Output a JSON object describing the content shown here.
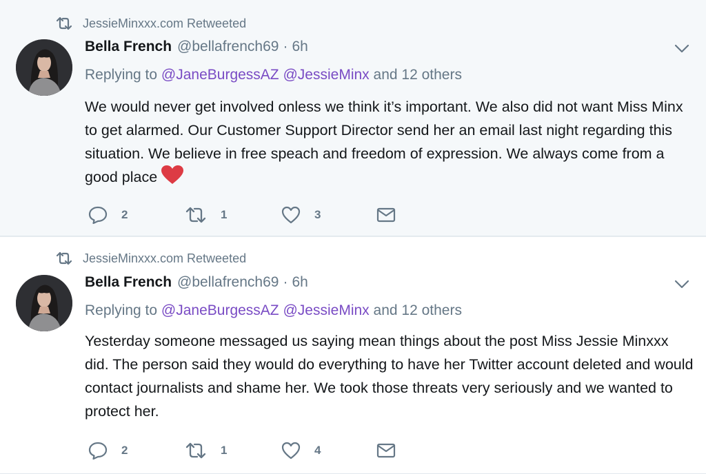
{
  "tweets": [
    {
      "retweeted_by": "JessieMinxxx.com Retweeted",
      "name": "Bella French",
      "handle": "@bellafrench69",
      "dot": "·",
      "time": "6h",
      "replying_prefix": "Replying to",
      "mention1": "@JaneBurgessAZ",
      "mention2": "@JessieMinx",
      "replying_suffix": "and 12 others",
      "text": "We would never get involved onless we think it’s important. We also did not want Miss Minx to get alarmed. Our Customer Support Director send her an email last night regarding this situation. We believe in free speach and freedom of expression. We always come from a good place",
      "emoji": "red-heart",
      "replies": "2",
      "retweets": "1",
      "likes": "3"
    },
    {
      "retweeted_by": "JessieMinxxx.com Retweeted",
      "name": "Bella French",
      "handle": "@bellafrench69",
      "dot": "·",
      "time": "6h",
      "replying_prefix": "Replying to",
      "mention1": "@JaneBurgessAZ",
      "mention2": "@JessieMinx",
      "replying_suffix": "and 12 others",
      "text": "Yesterday someone messaged us saying mean things about the post Miss Jessie Minxxx did. The person said they would do everything to have her Twitter account deleted and would contact journalists and shame her. We took those threats very seriously and we wanted to protect her.",
      "replies": "2",
      "retweets": "1",
      "likes": "4"
    }
  ],
  "colors": {
    "muted": "#657786",
    "mention": "#794bc4",
    "text": "#14171a",
    "heart": "#e0245e"
  },
  "icons": [
    "retweet-icon",
    "chevron-down-icon",
    "reply-icon",
    "like-icon",
    "direct-message-icon",
    "heart-emoji"
  ]
}
